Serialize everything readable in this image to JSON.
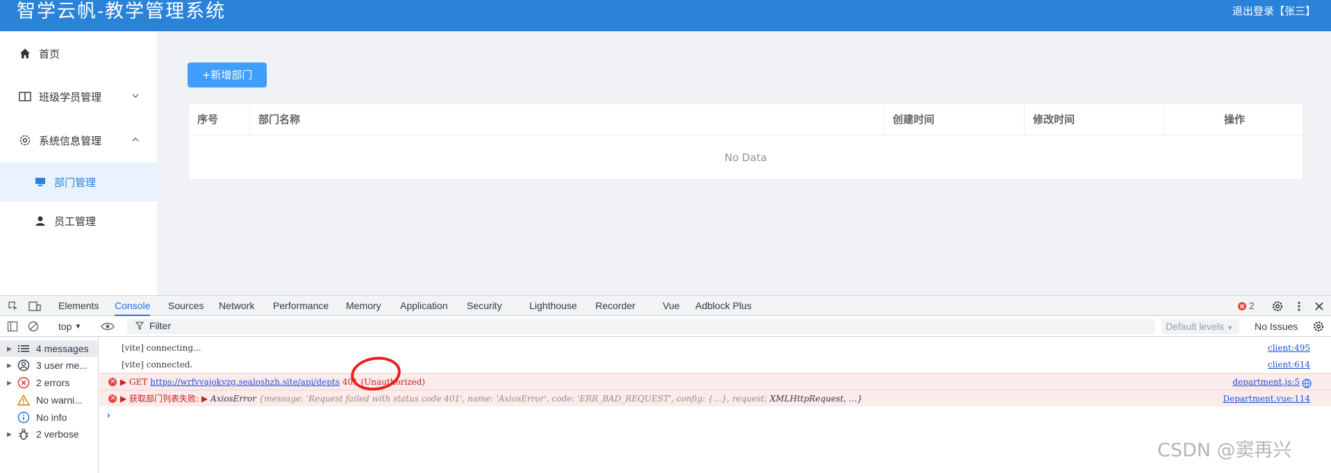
{
  "header": {
    "title": "智学云帆-教学管理系统",
    "logout": "退出登录【张三】"
  },
  "sidebar": {
    "items": [
      {
        "label": "首页",
        "icon": "home-icon"
      },
      {
        "label": "班级学员管理",
        "icon": "book-icon",
        "expanded": false
      },
      {
        "label": "系统信息管理",
        "icon": "gear-icon",
        "expanded": true
      },
      {
        "label": "部门管理",
        "icon": "monitor-icon",
        "active": true
      },
      {
        "label": "员工管理",
        "icon": "user-icon"
      }
    ]
  },
  "main": {
    "add_button": "+新增部门",
    "table": {
      "columns": [
        "序号",
        "部门名称",
        "创建时间",
        "修改时间",
        "操作"
      ],
      "empty_text": "No Data"
    }
  },
  "devtools": {
    "tabs": [
      "Elements",
      "Console",
      "Sources",
      "Network",
      "Performance",
      "Memory",
      "Application",
      "Security",
      "Lighthouse",
      "Recorder",
      "Vue",
      "Adblock Plus"
    ],
    "active_tab": "Console",
    "error_count": "2",
    "toolbar": {
      "context": "top",
      "filter_placeholder": "Filter",
      "levels": "Default levels",
      "issues": "No Issues"
    },
    "sidebar": [
      {
        "label": "4 messages",
        "icon": "list-icon"
      },
      {
        "label": "3 user me...",
        "icon": "user-circle-icon"
      },
      {
        "label": "2 errors",
        "icon": "error-icon"
      },
      {
        "label": "No warni...",
        "icon": "warning-icon"
      },
      {
        "label": "No info",
        "icon": "info-icon"
      },
      {
        "label": "2 verbose",
        "icon": "bug-icon"
      }
    ],
    "logs": [
      {
        "text": "[vite] connecting...",
        "source": "client:495"
      },
      {
        "text": "[vite] connected.",
        "source": "client:614"
      },
      {
        "prefix": "▶ GET ",
        "url": "https://wrfvvajokvzg.sealoshzh.site/api/depts",
        "status": " 401 (Unauthorized)",
        "source": "department.js:5"
      },
      {
        "prefix": "▶ 获取部门列表失败:  ▶ ",
        "error_name": "AxiosError",
        "detail": " {message: 'Request failed with status code 401', name: 'AxiosError', code: 'ERR_BAD_REQUEST', config: {…}, request: ",
        "request": "XMLHttpRequest",
        "tail": ",  …}",
        "source": "Department.vue:114"
      }
    ]
  },
  "watermark": "CSDN @窦再兴",
  "colors": {
    "header": "#2b82d9",
    "primary": "#409eff",
    "error": "#c5221f"
  }
}
